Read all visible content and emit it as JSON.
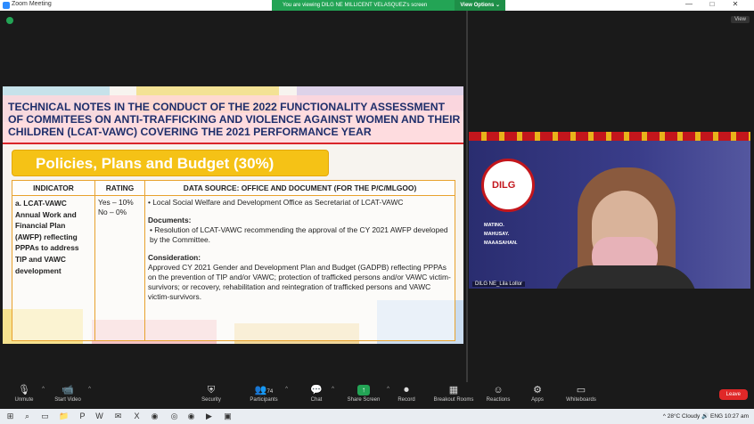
{
  "window": {
    "title": "Zoom Meeting",
    "controls": [
      "—",
      "□",
      "✕"
    ]
  },
  "share_banner": {
    "text": "You are viewing DILG NE MILLICENT VELASQUEZ's screen",
    "view_options": "View Options ⌄"
  },
  "view_button": "View",
  "slide": {
    "title": "TECHNICAL NOTES IN THE CONDUCT OF THE 2022 FUNCTIONALITY ASSESSMENT OF COMMITEES ON ANTI-TRAFFICKING AND VIOLENCE AGAINST WOMEN AND THEIR CHILDREN (LCAT-VAWC) COVERING THE 2021 PERFORMANCE YEAR",
    "section": "Policies, Plans and Budget (30%)",
    "headers": [
      "INDICATOR",
      "RATING",
      "DATA SOURCE: OFFICE AND DOCUMENT (FOR THE P/C/MLGOO)"
    ],
    "indicator": "a. LCAT-VAWC Annual Work and Financial Plan (AWFP) reflecting PPPAs to address TIP and VAWC development",
    "rating": [
      "Yes – 10%",
      "No – 0%"
    ],
    "ds_bullet1": "•  Local Social Welfare and Development Office as Secretariat of LCAT-VAWC",
    "ds_documents_label": "Documents:",
    "ds_bullet2": "•  Resolution of LCAT-VAWC recommending the approval of the CY 2021 AWFP developed by the Committee.",
    "ds_consideration_label": "Consideration:",
    "ds_consideration": "Approved CY 2021 Gender and Development Plan and Budget (GADPB) reflecting PPPAs on the prevention of TIP and/or VAWC; protection of trafficked persons and/or VAWC victim-survivors; or recovery, rehabilitation and reintegration of trafficked persons and VAWC victim-survivors."
  },
  "camera": {
    "logo": "DILG",
    "motto": [
      "MATINO.",
      "MAHUSAY.",
      "MAAASAHAN."
    ],
    "participant_name": "DILG NE_Lila Lollor"
  },
  "toolbar": {
    "unmute": "Unmute",
    "start_video": "Start Video",
    "security": "Security",
    "participants": "Participants",
    "participants_count": "74",
    "chat": "Chat",
    "share_screen": "Share Screen",
    "record": "Record",
    "breakout_rooms": "Breakout Rooms",
    "reactions": "Reactions",
    "apps": "Apps",
    "whiteboards": "Whiteboards",
    "leave": "Leave"
  },
  "taskbar": {
    "tray": "^  28°C  Cloudy   🔊  ENG   10:27 am"
  },
  "colors": {
    "accent": "#23a455",
    "leave": "#e02828",
    "slide_title": "#1f2f6b",
    "banner": "#f5c216"
  }
}
